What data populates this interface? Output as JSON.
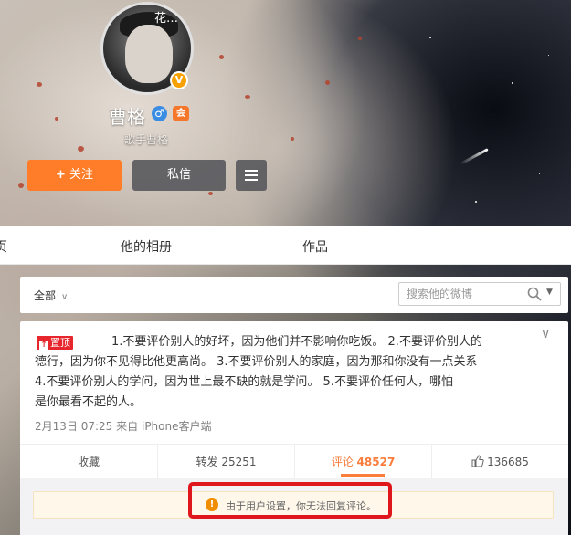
{
  "profile": {
    "avatar_watermark": "花…",
    "verified_mark": "V",
    "name": "曹格",
    "gender_symbol": "♂",
    "member_badge": "会",
    "bio": "歌手曹格",
    "follow_label": "关注",
    "follow_plus": "+",
    "message_label": "私信"
  },
  "tabs": [
    {
      "label": "页"
    },
    {
      "label": "他的相册"
    },
    {
      "label": "作品"
    }
  ],
  "filter": {
    "all_label": "全部",
    "all_chevron": "∨",
    "search_placeholder": "搜索他的微博",
    "search_drop": "▼"
  },
  "post": {
    "pin_icon": "↑",
    "pin_label": "置顶",
    "lines": [
      "1.不要评价别人的好坏，因为他们并不影响你吃饭。      2.不要评价别人的",
      "德行，因为你不见得比他更高尚。      3.不要评价别人的家庭，因为那和你没有一点关系",
      "      4.不要评价别人的学问，因为世上最不缺的就是学问。      5.不要评价任何人，哪怕",
      "是你最看不起的人。"
    ],
    "collapse_icon": "∨",
    "date": "2月13日 07:25",
    "source_prefix": "来自",
    "source": "iPhone客户端"
  },
  "actions": {
    "favorite": "收藏",
    "forward_label": "转发",
    "forward_count": "25251",
    "comment_label": "评论",
    "comment_count": "48527",
    "like_count": "136685"
  },
  "comment_notice": {
    "icon": "!",
    "text": "由于用户设置，你无法回复评论。"
  },
  "colors": {
    "accent": "#ff7d28",
    "comment_active": "#fa7d3c",
    "pin_red": "#e6262c",
    "highlight_red": "#e0161d",
    "warn": "#f18d00"
  },
  "icons": {
    "follow": "plus-icon",
    "menu": "hamburger-icon",
    "search": "search-icon",
    "like": "thumb-up-icon",
    "warning": "warning-icon",
    "gender": "male-icon",
    "verified": "verified-icon"
  }
}
